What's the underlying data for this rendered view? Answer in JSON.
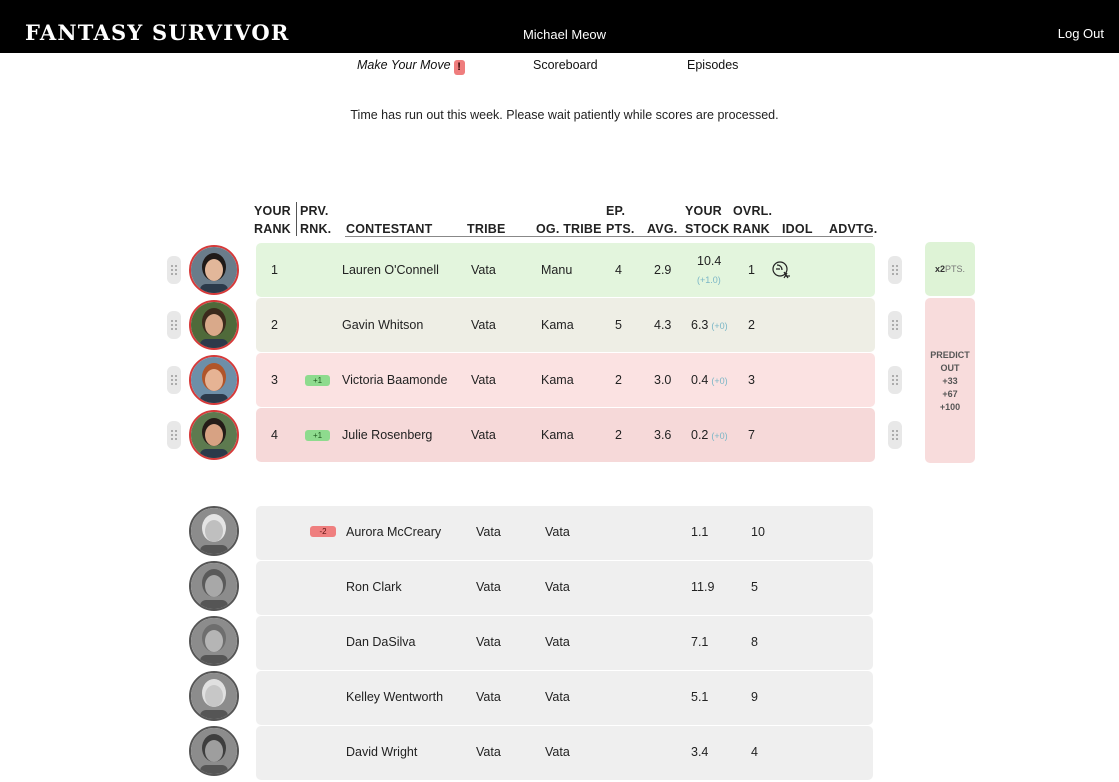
{
  "header": {
    "app_title": "FANTASY SURVIVOR",
    "user_name": "Michael Meow",
    "logout_label": "Log Out"
  },
  "nav": {
    "make_move": "Make Your Move",
    "alert": "!",
    "scoreboard": "Scoreboard",
    "episodes": "Episodes"
  },
  "notice": "Time has run out this week. Please wait patiently while scores are processed.",
  "columns": {
    "your_rank_1": "YOUR",
    "your_rank_2": "RANK",
    "prv_rank_1": "PRV.",
    "prv_rank_2": "RNK.",
    "contestant": "CONTESTANT",
    "tribe": "TRIBE",
    "og_tribe": "OG. TRIBE",
    "ep_pts_1": "EP.",
    "ep_pts_2": "PTS.",
    "avg": "AVG.",
    "your_stock_1": "YOUR",
    "your_stock_2": "STOCK",
    "ovrl_rank_1": "OVRL.",
    "ovrl_rank_2": "RANK",
    "idol": "IDOL",
    "advtg": "ADVTG."
  },
  "ranked": [
    {
      "rank": "1",
      "prv_change": "",
      "name": "Lauren O'Connell",
      "tribe": "Vata",
      "og_tribe": "Manu",
      "ep_pts": "4",
      "avg": "2.9",
      "stock": "10.4",
      "stock_change": "(+1.0)",
      "ovrl_rank": "1",
      "has_idol": true,
      "status": "green"
    },
    {
      "rank": "2",
      "prv_change": "",
      "name": "Gavin Whitson",
      "tribe": "Vata",
      "og_tribe": "Kama",
      "ep_pts": "5",
      "avg": "4.3",
      "stock": "6.3",
      "stock_change": "(+0)",
      "ovrl_rank": "2",
      "has_idol": false,
      "status": "beige"
    },
    {
      "rank": "3",
      "prv_change": "+1",
      "name": "Victoria Baamonde",
      "tribe": "Vata",
      "og_tribe": "Kama",
      "ep_pts": "2",
      "avg": "3.0",
      "stock": "0.4",
      "stock_change": "(+0)",
      "ovrl_rank": "3",
      "has_idol": false,
      "status": "pink"
    },
    {
      "rank": "4",
      "prv_change": "+1",
      "name": "Julie Rosenberg",
      "tribe": "Vata",
      "og_tribe": "Kama",
      "ep_pts": "2",
      "avg": "3.6",
      "stock": "0.2",
      "stock_change": "(+0)",
      "ovrl_rank": "7",
      "has_idol": false,
      "status": "pink2"
    }
  ],
  "side_boxes": {
    "multiplier_num": "x2",
    "multiplier_unit": "PTS.",
    "predict_1": "PREDICT",
    "predict_2": "OUT",
    "bonus_1": "+33",
    "bonus_2": "+67",
    "bonus_3": "+100"
  },
  "eliminated": [
    {
      "prv_change": "-2",
      "name": "Aurora McCreary",
      "tribe": "Vata",
      "og_tribe": "Vata",
      "stock": "1.1",
      "ovrl_rank": "10"
    },
    {
      "prv_change": "",
      "name": "Ron Clark",
      "tribe": "Vata",
      "og_tribe": "Vata",
      "stock": "11.9",
      "ovrl_rank": "5"
    },
    {
      "prv_change": "",
      "name": "Dan DaSilva",
      "tribe": "Vata",
      "og_tribe": "Vata",
      "stock": "7.1",
      "ovrl_rank": "8"
    },
    {
      "prv_change": "",
      "name": "Kelley Wentworth",
      "tribe": "Vata",
      "og_tribe": "Vata",
      "stock": "5.1",
      "ovrl_rank": "9"
    },
    {
      "prv_change": "",
      "name": "David Wright",
      "tribe": "Vata",
      "og_tribe": "Vata",
      "stock": "3.4",
      "ovrl_rank": "4"
    }
  ],
  "colors": {
    "active_ring": "#d63a3a",
    "row_green": "#e3f5dd",
    "row_pink": "#fbe2e2",
    "delta_up": "#8edb8e",
    "delta_down": "#ef7f7f"
  }
}
